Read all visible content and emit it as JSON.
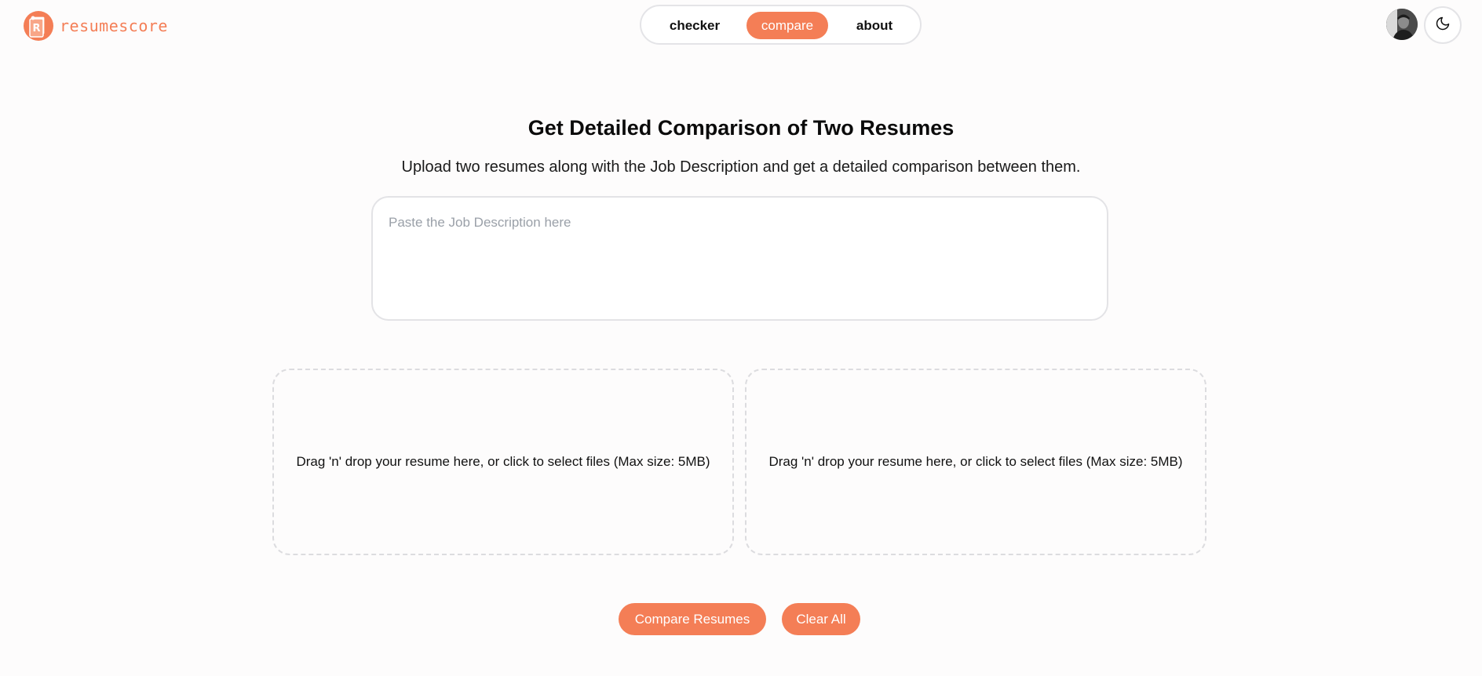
{
  "header": {
    "logo_text": "resumescore",
    "logo_icon": "resume-document-icon",
    "nav": [
      {
        "label": "checker",
        "active": false
      },
      {
        "label": "compare",
        "active": true
      },
      {
        "label": "about",
        "active": false
      }
    ],
    "avatar_icon": "user-avatar",
    "theme_toggle_icon": "moon-icon"
  },
  "main": {
    "title": "Get Detailed Comparison of Two Resumes",
    "subtitle": "Upload two resumes along with the Job Description and get a detailed comparison between them.",
    "job_description": {
      "value": "",
      "placeholder": "Paste the Job Description here"
    },
    "dropzones": [
      {
        "text": "Drag 'n' drop your resume here, or click to select files (Max size: 5MB)"
      },
      {
        "text": "Drag 'n' drop your resume here, or click to select files (Max size: 5MB)"
      }
    ],
    "buttons": {
      "compare_label": "Compare Resumes",
      "clear_label": "Clear All"
    }
  },
  "colors": {
    "accent": "#f47e56",
    "background": "#fdfcfc",
    "border": "#e4e4e7"
  }
}
